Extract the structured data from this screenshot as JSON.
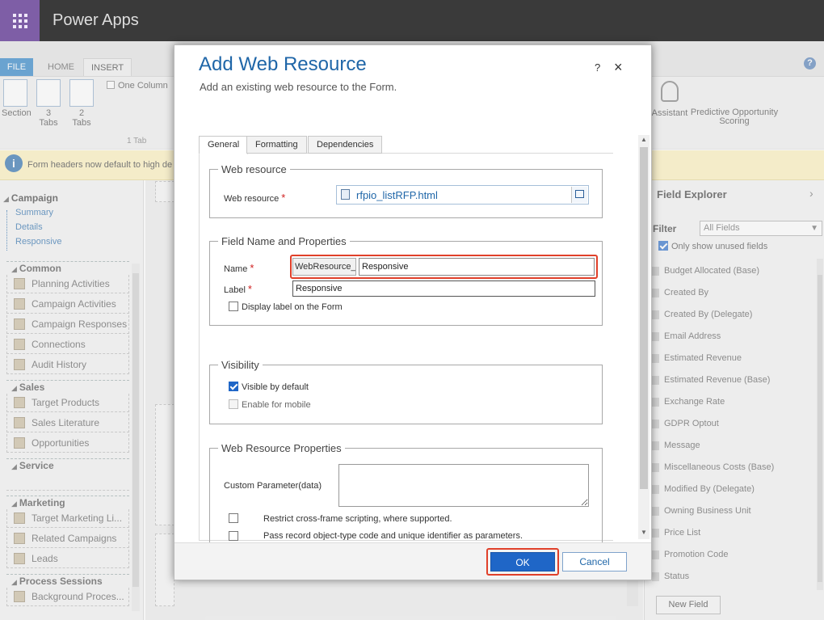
{
  "suite": {
    "app_title": "Power Apps"
  },
  "ribbon": {
    "tabs": [
      "FILE",
      "HOME",
      "INSERT"
    ],
    "buttons": {
      "section": "Section",
      "three_tabs": [
        "3",
        "Tabs"
      ],
      "two_tabs": [
        "2",
        "Tabs"
      ],
      "one_column": "One Column",
      "group_label": "1 Tab",
      "assistant": "Assistant",
      "predictive": [
        "Predictive Opportunity",
        "Scoring"
      ]
    },
    "help": "?"
  },
  "notification": {
    "text": "Form headers now default to high de"
  },
  "left_nav": {
    "entity": "Campaign",
    "links": [
      "Summary",
      "Details",
      "Responsive"
    ],
    "sections": [
      {
        "title": "Common",
        "items": [
          "Planning Activities",
          "Campaign Activities",
          "Campaign Responses",
          "Connections",
          "Audit History"
        ]
      },
      {
        "title": "Sales",
        "items": [
          "Target Products",
          "Sales Literature",
          "Opportunities"
        ]
      },
      {
        "title": "Service",
        "items": []
      },
      {
        "title": "Marketing",
        "items": [
          "Target Marketing Li...",
          "Related Campaigns",
          "Leads"
        ]
      },
      {
        "title": "Process Sessions",
        "items": [
          "Background Proces..."
        ]
      }
    ]
  },
  "field_explorer": {
    "title": "Field Explorer",
    "filter_label": "Filter",
    "filter_value": "All Fields",
    "only_unused": "Only show unused fields",
    "fields": [
      "Budget Allocated (Base)",
      "Created By",
      "Created By (Delegate)",
      "Email Address",
      "Estimated Revenue",
      "Estimated Revenue (Base)",
      "Exchange Rate",
      "GDPR Optout",
      "Message",
      "Miscellaneous Costs (Base)",
      "Modified By (Delegate)",
      "Owning Business Unit",
      "Price List",
      "Promotion Code",
      "Status"
    ],
    "new_field": "New Field"
  },
  "dialog": {
    "title": "Add Web Resource",
    "subtitle": "Add an existing web resource to the Form.",
    "help": "?",
    "close": "×",
    "tabs": [
      "General",
      "Formatting",
      "Dependencies"
    ],
    "web_resource_group": {
      "legend": "Web resource",
      "field_label": "Web resource",
      "value": "rfpio_listRFP.html"
    },
    "field_name_group": {
      "legend": "Field Name and Properties",
      "name_label": "Name",
      "name_prefix": "WebResource_",
      "name_value": "Responsive",
      "label_label": "Label",
      "label_value": "Responsive",
      "display_label": "Display label on the Form"
    },
    "visibility_group": {
      "legend": "Visibility",
      "visible_default": "Visible by default",
      "enable_mobile": "Enable for mobile"
    },
    "properties_group": {
      "legend": "Web Resource Properties",
      "custom_param": "Custom Parameter(data)",
      "restrict": "Restrict cross-frame scripting, where supported.",
      "pass_record": "Pass record object-type code and unique identifier as parameters."
    },
    "required_mark": "*",
    "ok": "OK",
    "cancel": "Cancel"
  }
}
